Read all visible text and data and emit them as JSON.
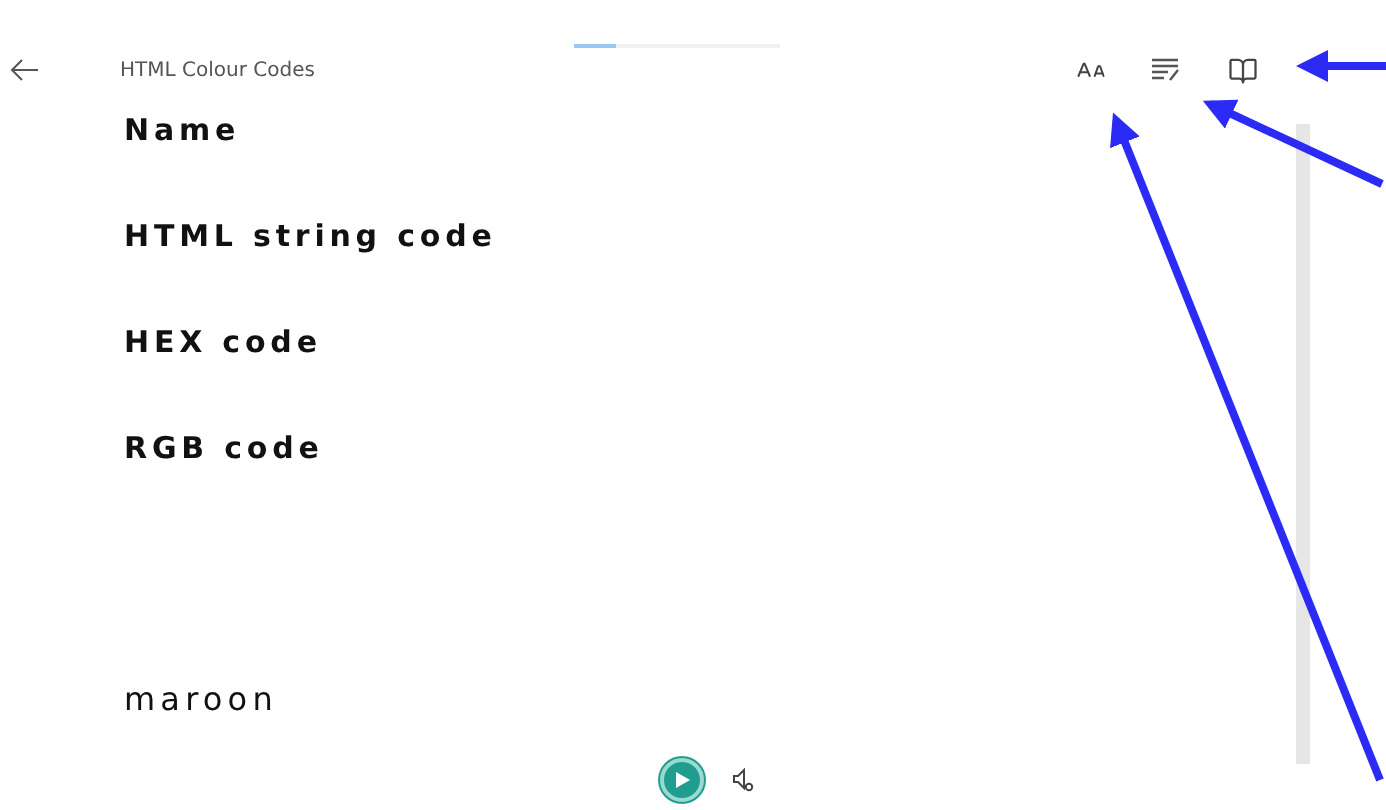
{
  "reading_progress": {
    "level": 0.2
  },
  "header": {
    "title": "HTML Colour Codes"
  },
  "content": [
    {
      "kind": "heading",
      "text": "Name"
    },
    {
      "kind": "heading",
      "text": "HTML string code"
    },
    {
      "kind": "heading",
      "text": "HEX code"
    },
    {
      "kind": "heading",
      "text": "RGB code"
    },
    {
      "kind": "body",
      "text": "maroon"
    }
  ]
}
